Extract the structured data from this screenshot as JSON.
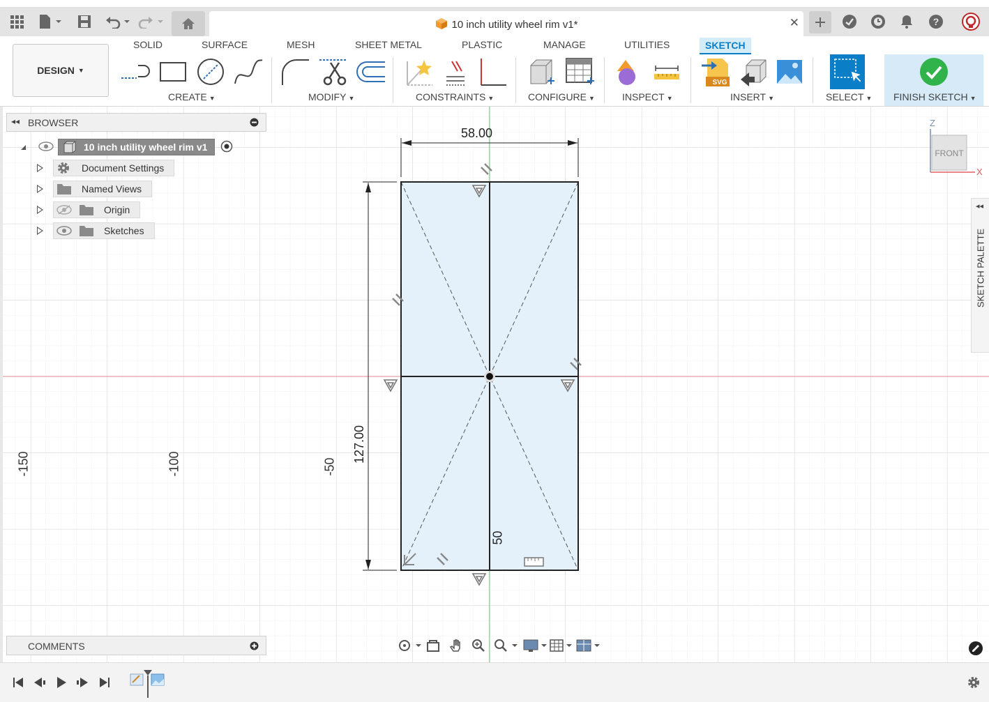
{
  "window": {
    "document_title": "10 inch utility wheel rim v1*"
  },
  "toolbar": {
    "workspace_button": "DESIGN",
    "tabs": [
      "SOLID",
      "SURFACE",
      "MESH",
      "SHEET METAL",
      "PLASTIC",
      "MANAGE",
      "UTILITIES",
      "SKETCH"
    ],
    "active_tab": "SKETCH",
    "groups": {
      "create": "CREATE",
      "modify": "MODIFY",
      "constraints": "CONSTRAINTS",
      "configure": "CONFIGURE",
      "inspect": "INSPECT",
      "insert": "INSERT",
      "select": "SELECT",
      "finish": "FINISH SKETCH"
    },
    "svg_badge": "SVG"
  },
  "browser": {
    "title": "BROWSER",
    "root": "10 inch utility wheel rim v1",
    "items": [
      "Document Settings",
      "Named Views",
      "Origin",
      "Sketches"
    ]
  },
  "comments": {
    "label": "COMMENTS"
  },
  "viewport": {
    "axis_labels": [
      "-150",
      "-100",
      "-50"
    ],
    "dimension_width": "58.00",
    "dimension_height": "127.00",
    "inner_label": "50",
    "viewcube_face": "FRONT",
    "axis_z": "Z",
    "axis_x": "X"
  },
  "palette": {
    "label": "SKETCH PALETTE"
  },
  "colors": {
    "accent": "#0a7ec7",
    "sketch_fill": "#e4f1fb",
    "finish_check": "#2fb34a",
    "red_axis": "#e08a8a",
    "green_axis": "#7cc98a"
  }
}
